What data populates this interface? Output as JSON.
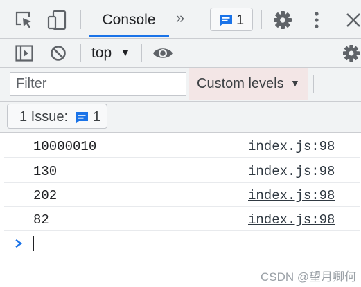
{
  "tabbar": {
    "console_tab": "Console",
    "more_tabs": "»",
    "messages_count": "1"
  },
  "toolbar": {
    "context": "top",
    "context_caret": "▼"
  },
  "filterbar": {
    "filter_placeholder": "Filter",
    "levels_label": "Custom levels",
    "levels_caret": "▼"
  },
  "issues": {
    "label": "1 Issue:",
    "count": "1"
  },
  "console": {
    "rows": [
      {
        "message": "10000010",
        "source": "index.js:98"
      },
      {
        "message": "130",
        "source": "index.js:98"
      },
      {
        "message": "202",
        "source": "index.js:98"
      },
      {
        "message": "82",
        "source": "index.js:98"
      }
    ]
  },
  "watermark": "CSDN @望月卿何",
  "colors": {
    "accent": "#1a73e8",
    "toolbar_bg": "#f1f3f4",
    "levels_bg": "#f3e6e6"
  },
  "icons": {
    "inspect": "inspect-element-icon",
    "device": "device-toggle-icon",
    "messages": "message-icon",
    "settings": "gear-icon",
    "menu": "kebab-menu-icon",
    "close": "close-icon",
    "sidebar": "sidebar-toggle-icon",
    "clear": "clear-console-icon",
    "live_expression": "eye-icon",
    "prompt": "chevron-right-icon"
  }
}
